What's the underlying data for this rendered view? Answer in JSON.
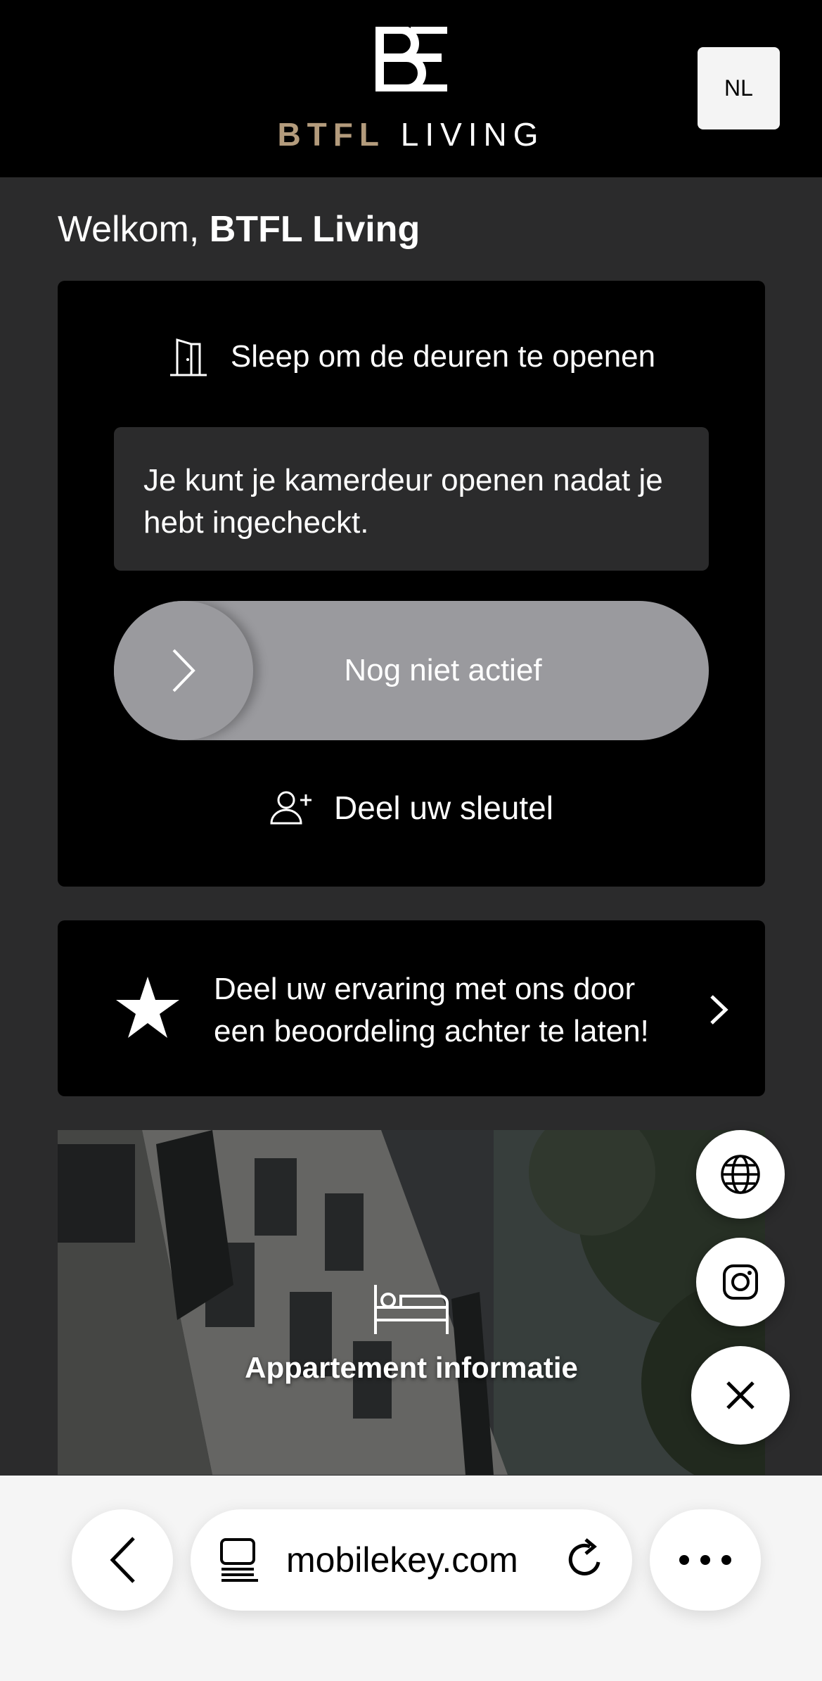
{
  "header": {
    "logo_mark_letters": "BE",
    "logo_brand": "BTFL",
    "logo_suffix": "LIVING",
    "language_button": "NL",
    "brand_gold": "#b39b7c"
  },
  "welcome": {
    "prefix": "Welkom,",
    "name": "BTFL Living"
  },
  "door_card": {
    "icon": "door-icon",
    "title": "Sleep om de deuren te openen",
    "info": "Je kunt je kamerdeur openen nadat je hebt ingecheckt.",
    "slider_label": "Nog niet actief",
    "share_icon": "add-person-icon",
    "share_label": "Deel uw sleutel"
  },
  "review_card": {
    "icon": "star-icon",
    "text": "Deel uw ervaring met ons door een beoordeling achter te laten!",
    "chevron_icon": "chevron-right-icon"
  },
  "apartment_card": {
    "icon": "bed-icon",
    "label": "Appartement informatie"
  },
  "fab": {
    "items": [
      "globe-icon",
      "instagram-icon",
      "close-icon"
    ]
  },
  "browser": {
    "url_prefix": "",
    "url": "mobilekey.com",
    "back_icon": "chevron-left-icon",
    "tabs_icon": "tab-icon",
    "reload_icon": "reload-icon",
    "more_icon": "ellipsis-icon"
  }
}
